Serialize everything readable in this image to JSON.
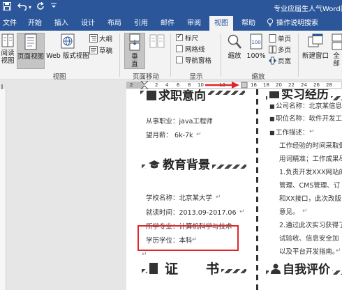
{
  "titlebar": {
    "title": "专业应届生人气Word简",
    "save_icon": "save-icon",
    "undo_icon": "undo-icon",
    "refresh_icon": "redo-icon",
    "more_icon": "customize-arrow-icon"
  },
  "tabs": [
    {
      "label": "文件"
    },
    {
      "label": "开始"
    },
    {
      "label": "插入"
    },
    {
      "label": "设计"
    },
    {
      "label": "布局"
    },
    {
      "label": "引用"
    },
    {
      "label": "邮件"
    },
    {
      "label": "审阅"
    },
    {
      "label": "视图",
      "active": true
    },
    {
      "label": "帮助"
    },
    {
      "label": "操作说明搜索"
    }
  ],
  "ribbon": {
    "views": {
      "read_mode_line1": "阅读",
      "read_mode_line2": "视图",
      "print_layout": "页面视图",
      "web_layout": "Web 版式视图",
      "outline": "大纲",
      "draft": "草稿",
      "group_label": "视图"
    },
    "page_movement": {
      "vertical_line1": "垂",
      "vertical_line2": "直",
      "side_to_side": "",
      "group_label": "页面移动"
    },
    "show": {
      "ruler": "标尺",
      "gridlines": "网格线",
      "nav_pane": "导航窗格",
      "group_label": "显示",
      "ruler_checked": true,
      "gridlines_checked": false,
      "nav_pane_checked": false
    },
    "zoom": {
      "zoom": "缩放",
      "hundred": "100%",
      "one_page": "单页",
      "multi_page": "多页",
      "page_width": "页宽",
      "group_label": "缩放"
    },
    "window": {
      "new_window": "新建窗口",
      "arrange_all": "全部"
    }
  },
  "ruler": {
    "numbers": [
      "2",
      "2",
      "4",
      "6",
      "8",
      "10",
      "12",
      "16",
      "18",
      "20",
      "22",
      "24",
      "26",
      "28"
    ],
    "arrow_color": "#e0262b"
  },
  "document": {
    "left": {
      "heading_jobintent": "求职意向",
      "job_position": "从事职业：java工程师",
      "salary": "望月薪： 6k-7k",
      "heading_education": "教育背景",
      "school": "学校名称：北京某大学",
      "period": "就读时间：2013.09-2017.06",
      "major": "所学专业：计算机科学与技术",
      "degree": "学历学位：本科",
      "heading_cert_1": "证",
      "heading_cert_2": "书"
    },
    "right": {
      "heading_experience": "实习经历",
      "company": "公司名称：北京某信息",
      "position": "职位名称：软件开发工",
      "desc_label": "工作描述：",
      "line1": "工作经验的时间采取倒",
      "line2": "用词精准；工作成果尽",
      "line3": "1.负责开发XXX网站的",
      "line4": "管理、CMS管理、订",
      "line5": "和XX接口，此次改版",
      "line6": "意见。",
      "line7": "2.通过此次实习获得了",
      "line8": "试验收、信息安全加",
      "line9": "以及平台开发指南。",
      "heading_self": "自我评价"
    },
    "highlight_color": "#e0262b"
  }
}
